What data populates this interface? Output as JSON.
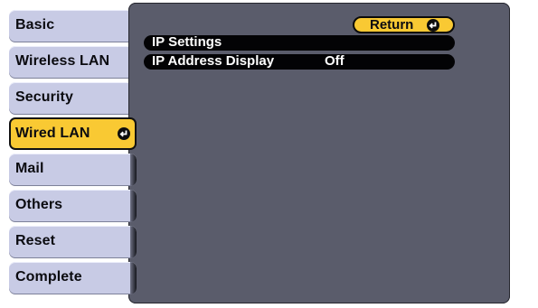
{
  "sidebar": {
    "items": [
      {
        "label": "Basic"
      },
      {
        "label": "Wireless LAN"
      },
      {
        "label": "Security"
      },
      {
        "label": "Wired LAN",
        "selected": true
      },
      {
        "label": "Mail"
      },
      {
        "label": "Others"
      },
      {
        "label": "Reset"
      },
      {
        "label": "Complete"
      }
    ]
  },
  "main": {
    "return_label": "Return",
    "rows": [
      {
        "label": "IP Settings",
        "value": ""
      },
      {
        "label": "IP Address Display",
        "value": "Off"
      }
    ]
  },
  "colors": {
    "tab_bg": "#c8cbe5",
    "selected_bg": "#f9c933",
    "panel_bg": "#5a5c6b",
    "row_bg": "#030305"
  },
  "icons": {
    "enter": "enter-return-icon"
  }
}
